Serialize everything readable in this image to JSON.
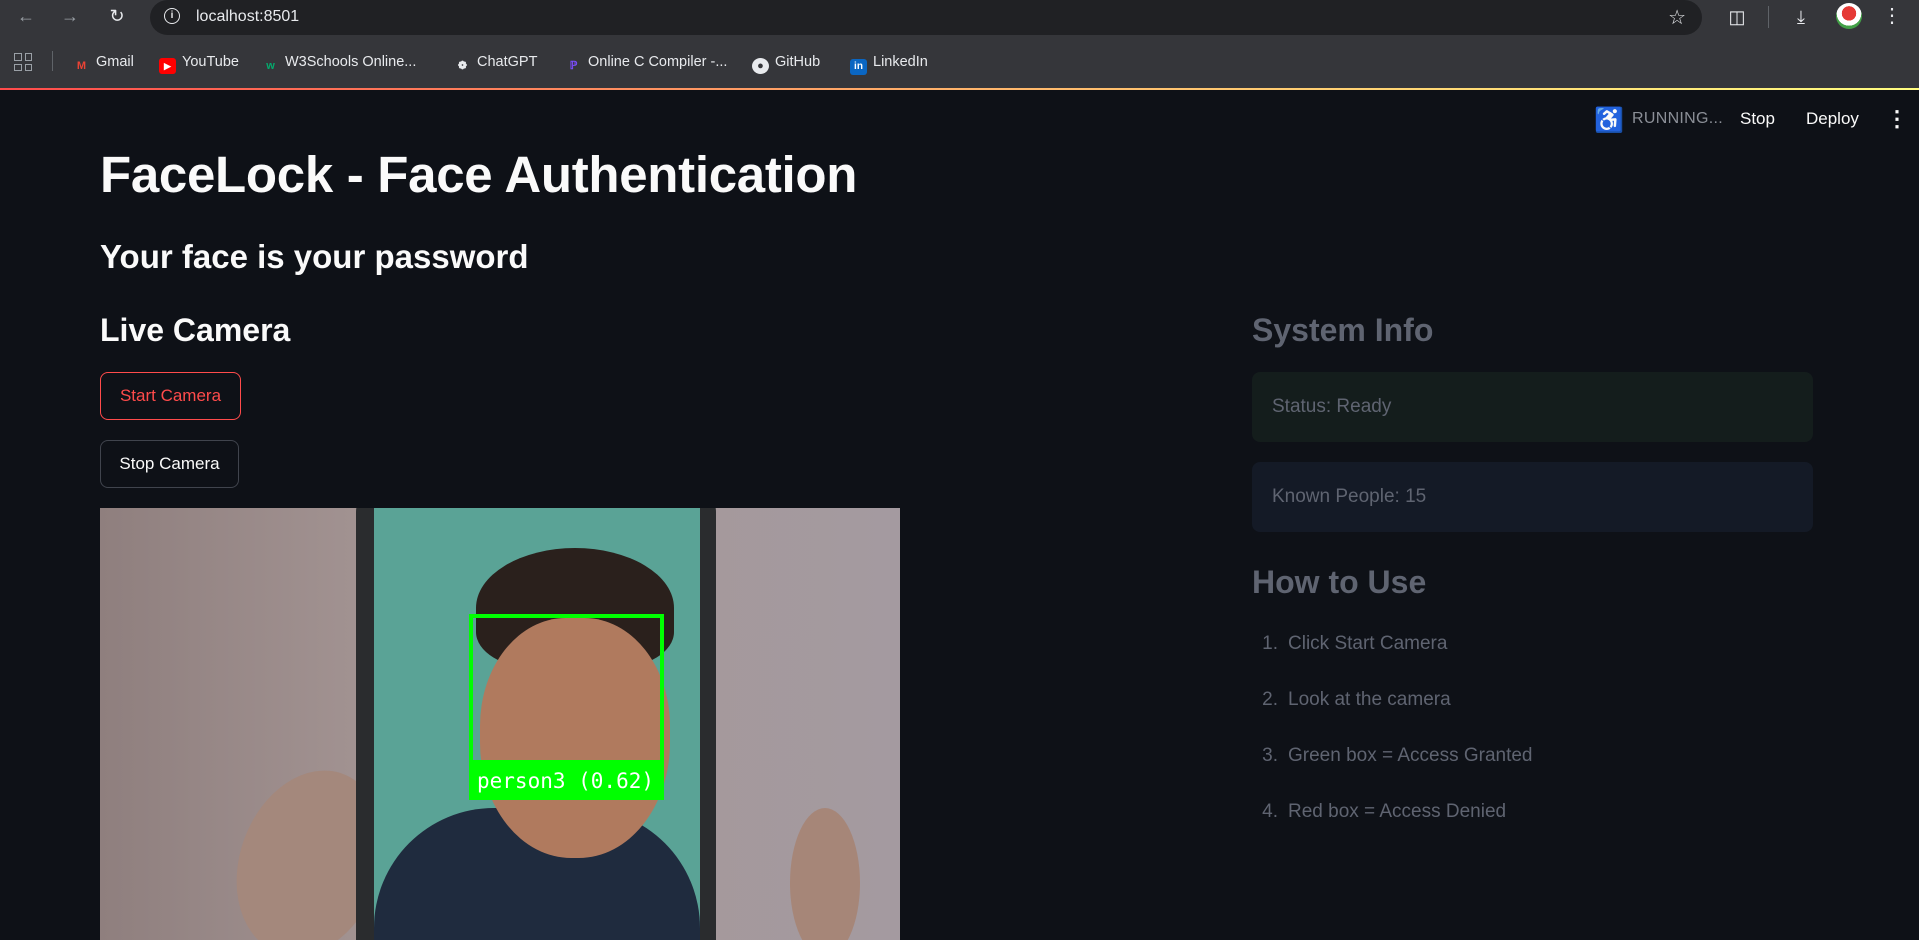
{
  "browser": {
    "url": "localhost:8501",
    "bookmarks": [
      {
        "label": "Gmail",
        "icon": "gmail-icon"
      },
      {
        "label": "YouTube",
        "icon": "youtube-icon"
      },
      {
        "label": "W3Schools Online...",
        "icon": "w3schools-icon"
      },
      {
        "label": "ChatGPT",
        "icon": "chatgpt-icon"
      },
      {
        "label": "Online C Compiler -...",
        "icon": "compiler-icon"
      },
      {
        "label": "GitHub",
        "icon": "github-icon"
      },
      {
        "label": "LinkedIn",
        "icon": "linkedin-icon"
      }
    ]
  },
  "app_header": {
    "running_text": "RUNNING...",
    "stop_label": "Stop",
    "deploy_label": "Deploy"
  },
  "main": {
    "title": "FaceLock - Face Authentication",
    "subtitle": "Your face is your password",
    "camera_heading": "Live Camera",
    "start_button": "Start Camera",
    "stop_button": "Stop Camera",
    "detection_label": "person3 (0.62)"
  },
  "sidebar": {
    "system_info_heading": "System Info",
    "status_text": "Status: Ready",
    "known_people_text": "Known People: 15",
    "how_to_heading": "How to Use",
    "steps": [
      {
        "num": "1.",
        "text": "Click Start Camera"
      },
      {
        "num": "2.",
        "text": "Look at the camera"
      },
      {
        "num": "3.",
        "text": "Green box = Access Granted"
      },
      {
        "num": "4.",
        "text": "Red box = Access Denied"
      }
    ]
  },
  "colors": {
    "background": "#0e1117",
    "accent": "#ff4b4b",
    "detection_box": "#00ff00"
  }
}
